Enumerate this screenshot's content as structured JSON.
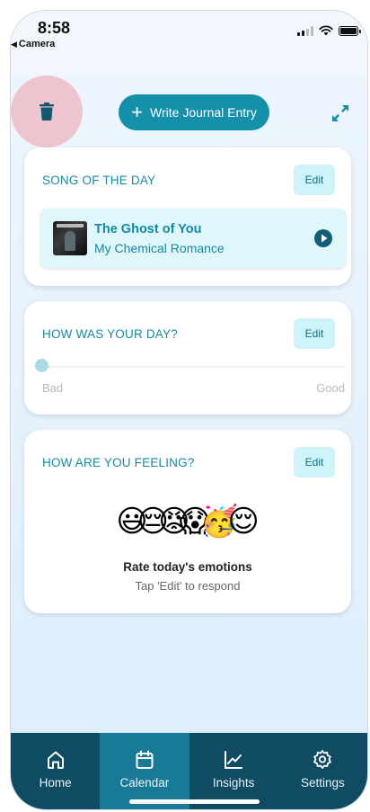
{
  "status_bar": {
    "time": "8:58",
    "back_app": "Camera"
  },
  "toolbar": {
    "write_label": "Write Journal Entry",
    "delete_icon": "trash-icon",
    "expand_icon": "expand-icon"
  },
  "song_card": {
    "title": "SONG OF THE DAY",
    "edit_label": "Edit",
    "song_title": "The Ghost of You",
    "artist": "My Chemical Romance"
  },
  "day_card": {
    "title": "HOW WAS YOUR DAY?",
    "edit_label": "Edit",
    "min_label": "Bad",
    "max_label": "Good",
    "rating": 0
  },
  "feeling_card": {
    "title": "HOW ARE YOU FEELING?",
    "edit_label": "Edit",
    "emojis": [
      "😃",
      "😔",
      "😡",
      "😱",
      "🥳",
      "😌"
    ],
    "prompt_title": "Rate today's emotions",
    "prompt_sub": "Tap 'Edit' to respond"
  },
  "tabs": [
    {
      "label": "Home",
      "icon": "home-icon",
      "active": false
    },
    {
      "label": "Calendar",
      "icon": "calendar-icon",
      "active": true
    },
    {
      "label": "Insights",
      "icon": "chart-icon",
      "active": false
    },
    {
      "label": "Settings",
      "icon": "gear-icon",
      "active": false
    }
  ],
  "colors": {
    "accent": "#1590ab",
    "tabbar": "#0f4c63",
    "tab_active": "#197a98",
    "edit_bg": "#cdf5f9"
  }
}
